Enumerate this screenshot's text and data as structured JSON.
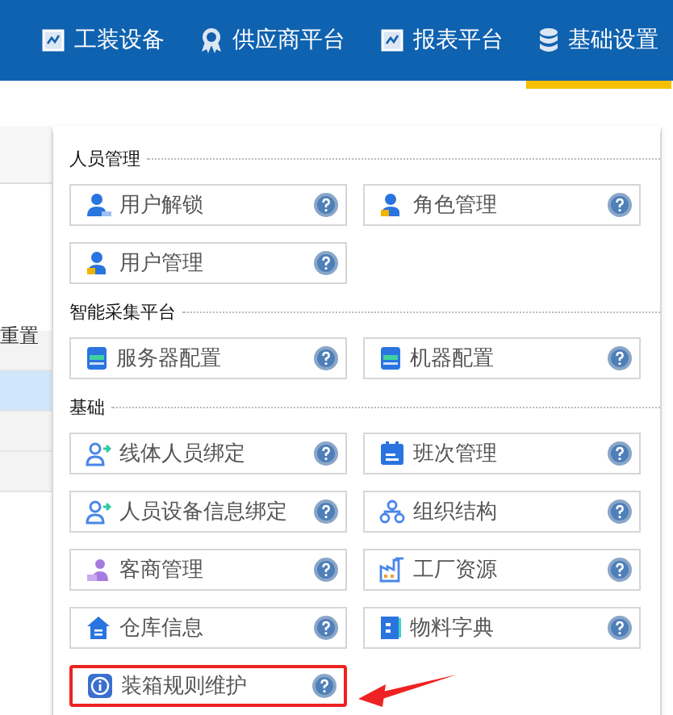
{
  "nav": [
    {
      "label": "工装设备",
      "selected": false
    },
    {
      "label": "供应商平台",
      "selected": false
    },
    {
      "label": "报表平台",
      "selected": false
    },
    {
      "label": "基础设置",
      "selected": true
    }
  ],
  "background": {
    "reset_label": "重置",
    "rows": [
      {
        "selected": false
      },
      {
        "selected": true
      },
      {
        "selected": false
      },
      {
        "selected": false
      }
    ]
  },
  "menu": {
    "sections": [
      {
        "title": "人员管理",
        "items": [
          {
            "label": "用户解锁",
            "highlighted": false
          },
          {
            "label": "角色管理",
            "highlighted": false
          },
          {
            "label": "用户管理",
            "highlighted": false
          }
        ]
      },
      {
        "title": "智能采集平台",
        "items": [
          {
            "label": "服务器配置",
            "highlighted": false
          },
          {
            "label": "机器配置",
            "highlighted": false
          }
        ]
      },
      {
        "title": "基础",
        "items": [
          {
            "label": "线体人员绑定",
            "highlighted": false
          },
          {
            "label": "班次管理",
            "highlighted": false
          },
          {
            "label": "人员设备信息绑定",
            "highlighted": false
          },
          {
            "label": "组织结构",
            "highlighted": false
          },
          {
            "label": "客商管理",
            "highlighted": false
          },
          {
            "label": "工厂资源",
            "highlighted": false
          },
          {
            "label": "仓库信息",
            "highlighted": false
          },
          {
            "label": "物料字典",
            "highlighted": false
          },
          {
            "label": "装箱规则维护",
            "highlighted": true
          }
        ]
      }
    ]
  }
}
